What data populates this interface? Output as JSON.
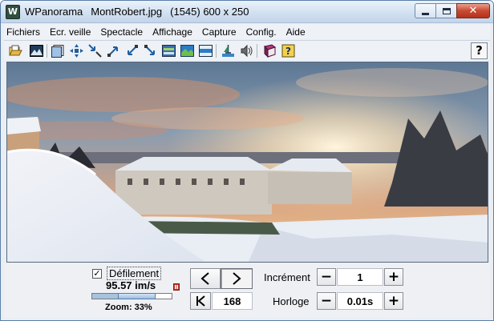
{
  "window": {
    "app_name": "WPanorama",
    "file_name": "MontRobert.jpg",
    "image_info": "(1545) 600 x 250",
    "app_icon_letter": "W"
  },
  "window_controls": {
    "minimize_icon": "minimize-icon",
    "maximize_icon": "maximize-icon",
    "close_icon": "close-icon",
    "close_glyph": "✕"
  },
  "menu": {
    "items": [
      "Fichiers",
      "Ecr. veille",
      "Spectacle",
      "Affichage",
      "Capture",
      "Config.",
      "Aide"
    ]
  },
  "toolbar": {
    "icons": [
      "open-icon",
      "image-icon",
      "slideshow-icon",
      "center-icon",
      "shrink-icon",
      "expand-icon",
      "zoom-in-icon",
      "zoom-out-icon",
      "fit-icon",
      "panorama-icon",
      "fit-width-icon",
      "water-icon",
      "sound-icon",
      "book-icon",
      "help-book-icon"
    ],
    "help_label": "?"
  },
  "controls": {
    "scroll_checkbox_checked": true,
    "checkbox_mark": "✓",
    "scroll_label": "Défilement",
    "speed": "95.57 im/s",
    "zoom_label": "Zoom: 33%",
    "zoom_fraction": 0.33,
    "position_value": "168",
    "increment_label": "Incrément",
    "increment_value": "1",
    "clock_label": "Horloge",
    "clock_value": "0.01s",
    "minus_label": "−",
    "plus_label": "+"
  },
  "colors": {
    "title_gradient_top": "#eaf2fb",
    "close_button": "#c84a31",
    "sky_sunset": "#e9a67a",
    "snow": "#eef2f8"
  }
}
